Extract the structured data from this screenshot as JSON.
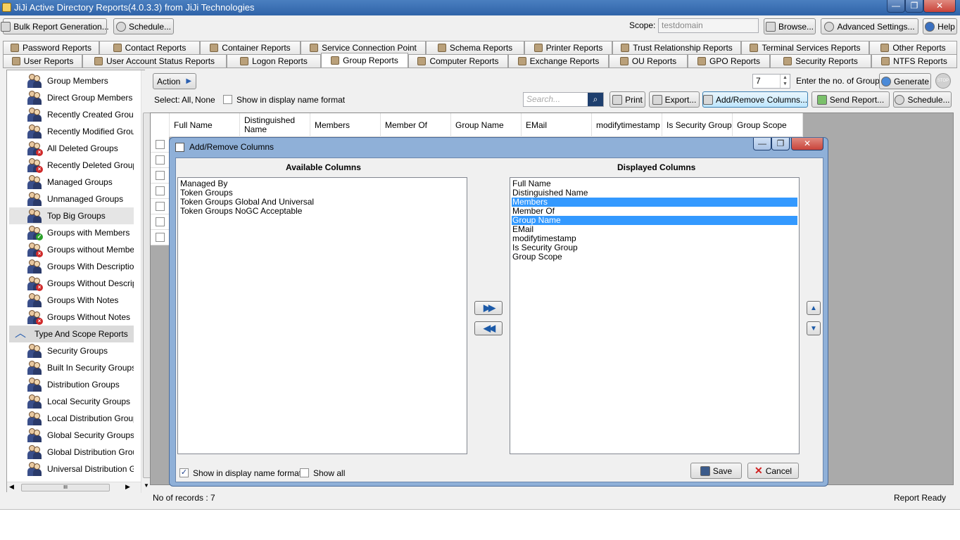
{
  "window": {
    "title": "JiJi Active Directory Reports(4.0.3.3) from JiJi Technologies"
  },
  "toolbar": {
    "bulk_label": "Bulk Report Generation...",
    "schedule_label": "Schedule...",
    "scope_label": "Scope:",
    "scope_value": "testdomain",
    "browse_label": "Browse...",
    "advanced_label": "Advanced Settings...",
    "help_label": "Help"
  },
  "tabs": {
    "row1": [
      "Password Reports",
      "Contact Reports",
      "Container Reports",
      "Service Connection Point",
      "Schema Reports",
      "Printer Reports",
      "Trust Relationship Reports",
      "Terminal Services Reports",
      "Other Reports"
    ],
    "row2": [
      "User Reports",
      "User Account Status Reports",
      "Logon Reports",
      "Group Reports",
      "Computer Reports",
      "Exchange Reports",
      "OU Reports",
      "GPO Reports",
      "Security Reports",
      "NTFS Reports"
    ],
    "active": "Group Reports"
  },
  "sidebar": {
    "items": [
      {
        "label": "Group Members",
        "badge": ""
      },
      {
        "label": "Direct Group Members",
        "badge": ""
      },
      {
        "label": "Recently Created Groups",
        "badge": ""
      },
      {
        "label": "Recently Modified Groups",
        "badge": ""
      },
      {
        "label": "All Deleted Groups",
        "badge": "x"
      },
      {
        "label": "Recently Deleted Groups",
        "badge": "x"
      },
      {
        "label": "Managed Groups",
        "badge": ""
      },
      {
        "label": "Unmanaged Groups",
        "badge": ""
      },
      {
        "label": "Top Big Groups",
        "badge": ""
      },
      {
        "label": "Groups with Members",
        "badge": "ok"
      },
      {
        "label": "Groups without Members",
        "badge": "x"
      },
      {
        "label": "Groups With Description",
        "badge": ""
      },
      {
        "label": "Groups Without Descriptio",
        "badge": "x"
      },
      {
        "label": "Groups With Notes",
        "badge": ""
      },
      {
        "label": "Groups Without Notes",
        "badge": "x"
      }
    ],
    "section_header": "Type And Scope Reports",
    "sub_items": [
      "Security Groups",
      "Built In Security Groups",
      "Distribution Groups",
      "Local Security Groups",
      "Local Distribution Groups",
      "Global Security Groups",
      "Global Distribution Groups",
      "Universal Distribution Grou"
    ],
    "hscroll_grip": "III"
  },
  "main": {
    "action_label": "Action",
    "group_count": "7",
    "group_count_label": "Enter the no. of Groups",
    "generate_label": "Generate",
    "stop_label": "STOP",
    "select_label": "Select:",
    "select_all": "All,",
    "select_none": "None",
    "display_name_format": "Show in display name format",
    "search_placeholder": "Search...",
    "print_label": "Print",
    "export_label": "Export...",
    "addremove_label": "Add/Remove Columns...",
    "send_label": "Send Report...",
    "schedule2_label": "Schedule..."
  },
  "grid": {
    "columns": [
      "Full Name",
      "Distinguished Name",
      "Members",
      "Member Of",
      "Group Name",
      "EMail",
      "modifytimestamp",
      "Is Security Group",
      "Group Scope"
    ],
    "row_count": 7
  },
  "status": {
    "records": "No of records : 7",
    "state": "Report Ready"
  },
  "dialog": {
    "title": "Add/Remove Columns",
    "available_header": "Available Columns",
    "displayed_header": "Displayed Columns",
    "available": [
      "Managed By",
      "Token Groups",
      "Token Groups Global And Universal",
      "Token Groups NoGC Acceptable"
    ],
    "displayed": [
      {
        "label": "Full Name",
        "selected": false
      },
      {
        "label": "Distinguished Name",
        "selected": false
      },
      {
        "label": "Members",
        "selected": true
      },
      {
        "label": "Member Of",
        "selected": false
      },
      {
        "label": "Group Name",
        "selected": true
      },
      {
        "label": "EMail",
        "selected": false
      },
      {
        "label": "modifytimestamp",
        "selected": false
      },
      {
        "label": "Is Security Group",
        "selected": false
      },
      {
        "label": "Group Scope",
        "selected": false
      }
    ],
    "show_display_name": "Show in display name format",
    "show_display_name_checked": true,
    "show_all": "Show all",
    "show_all_checked": false,
    "save_label": "Save",
    "cancel_label": "Cancel",
    "add_arrow": "▶▶",
    "remove_arrow": "◀◀",
    "up_arrow": "▲",
    "down_arrow": "▼"
  },
  "colors": {
    "accent": "#3399ff",
    "titlebar": "#2f63a8",
    "close": "#c9433a"
  }
}
